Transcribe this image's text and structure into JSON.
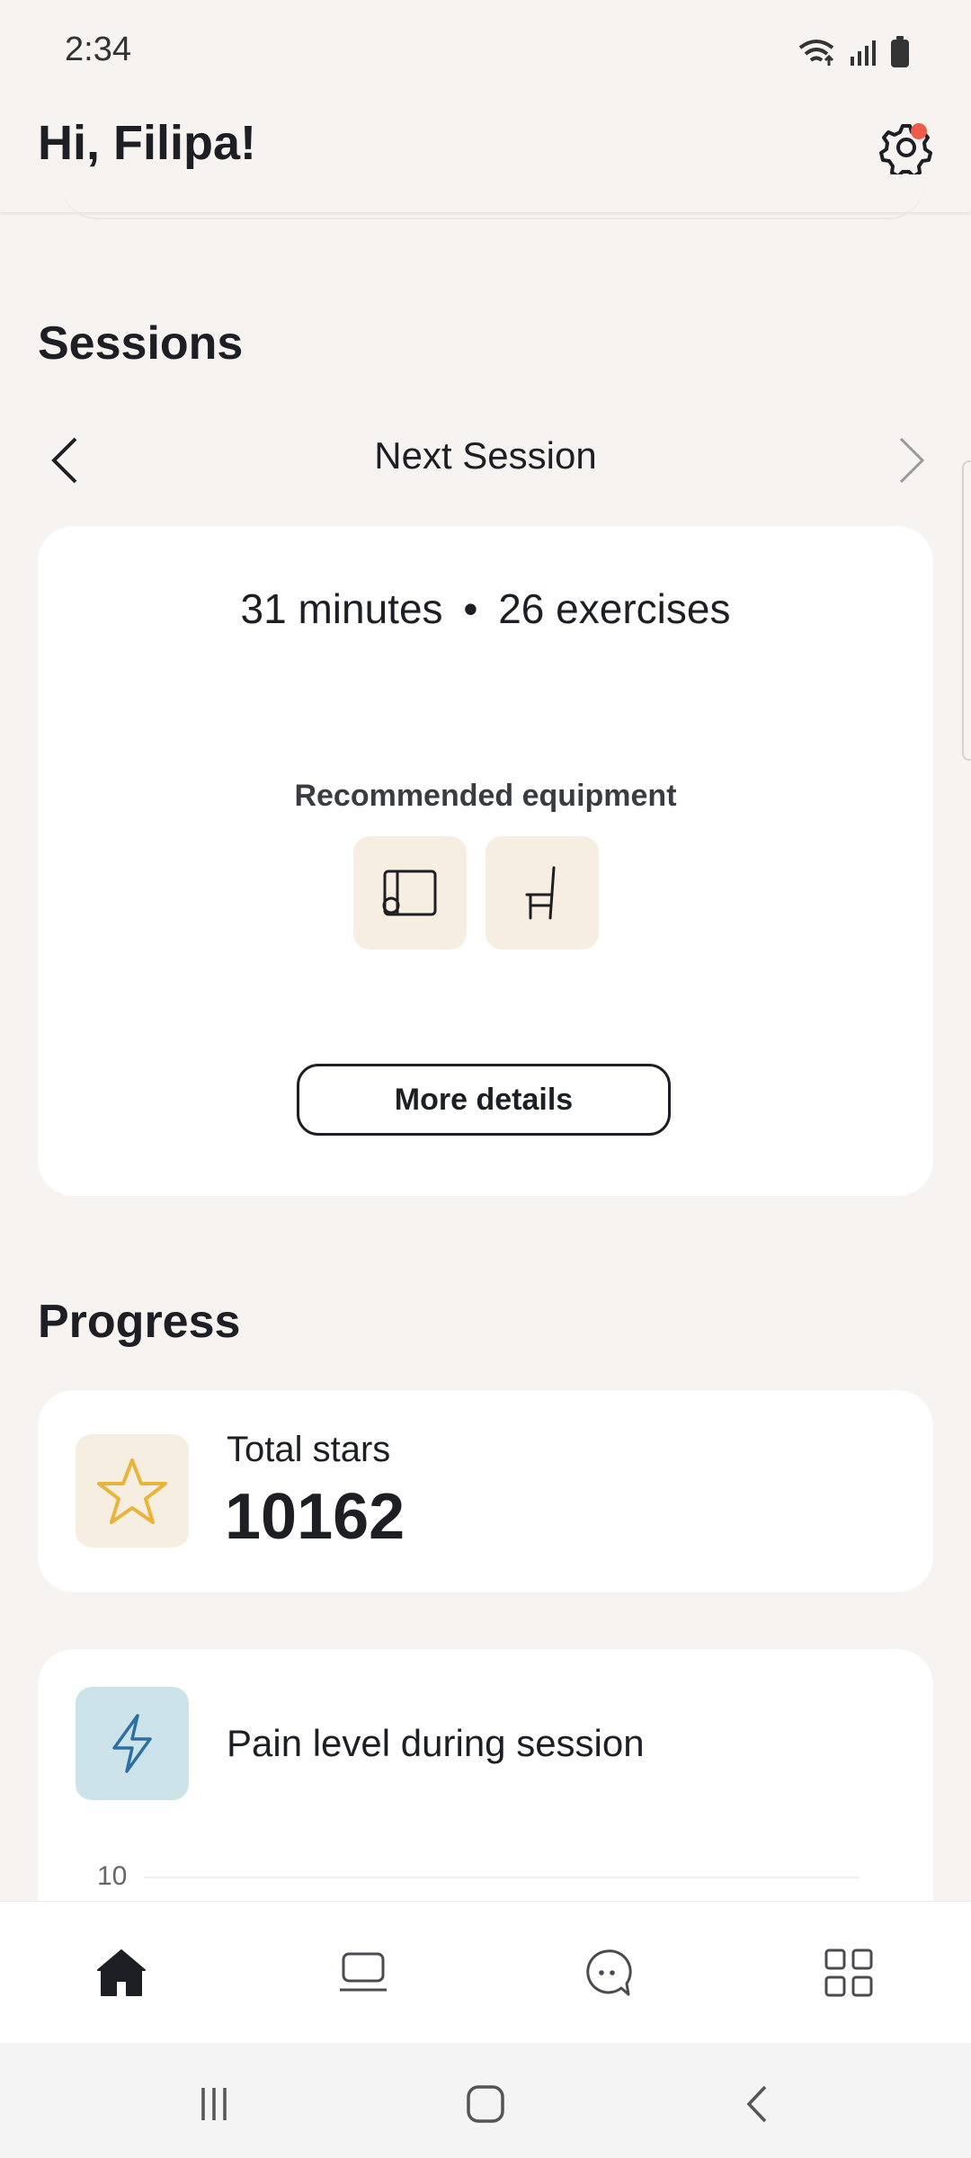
{
  "status_bar": {
    "time": "2:34"
  },
  "header": {
    "greeting": "Hi, Filipa!"
  },
  "sessions": {
    "title": "Sessions",
    "nav_title": "Next Session",
    "duration": "31 minutes",
    "separator": "•",
    "exercises": "26 exercises",
    "equipment_label": "Recommended equipment",
    "equipment": [
      "mat-icon",
      "chair-icon"
    ],
    "details_button": "More details"
  },
  "progress": {
    "title": "Progress",
    "stars_label": "Total stars",
    "stars_value": "10162",
    "pain_label": "Pain level during session",
    "pain_axis_top": "10"
  },
  "colors": {
    "background": "#f6f3f0",
    "star": "#e8b43a",
    "bolt": "#2d6fa3",
    "bolt_tile": "#cde3ea",
    "equip_tile": "#f7eee2",
    "notification": "#ef5a4c"
  },
  "bottom_nav": [
    "home-icon",
    "sessions-icon",
    "chat-icon",
    "grid-menu-icon"
  ]
}
